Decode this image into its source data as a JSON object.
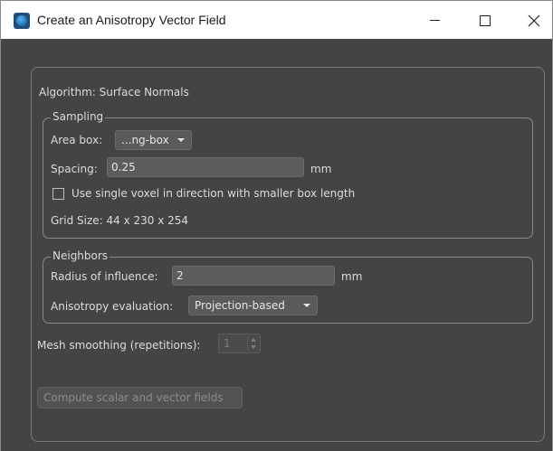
{
  "window": {
    "title": "Create an Anisotropy Vector Field",
    "icon": "app-icon"
  },
  "dialog": {
    "algorithm_label": "Algorithm: Surface Normals",
    "sampling": {
      "title": "Sampling",
      "area_box_label": "Area box:",
      "area_box_value": "...ng-box",
      "spacing_label": "Spacing:",
      "spacing_value": "0.25",
      "spacing_unit": "mm",
      "single_voxel_label": "Use single voxel in direction with smaller box length",
      "single_voxel_checked": false,
      "grid_size_label": "Grid Size:",
      "grid_size_value": "44 x 230 x 254"
    },
    "neighbors": {
      "title": "Neighbors",
      "radius_label": "Radius of influence:",
      "radius_value": "2",
      "radius_unit": "mm",
      "anisotropy_label": "Anisotropy evaluation:",
      "anisotropy_value": "Projection-based"
    },
    "mesh_smoothing_label": "Mesh smoothing (repetitions):",
    "mesh_smoothing_value": "1",
    "compute_button_label": "Compute scalar and vector fields"
  },
  "colors": {
    "background": "#444444",
    "titlebar": "#ffffff",
    "text": "#dcdcdc",
    "disabled_text": "#8c8c8c"
  }
}
